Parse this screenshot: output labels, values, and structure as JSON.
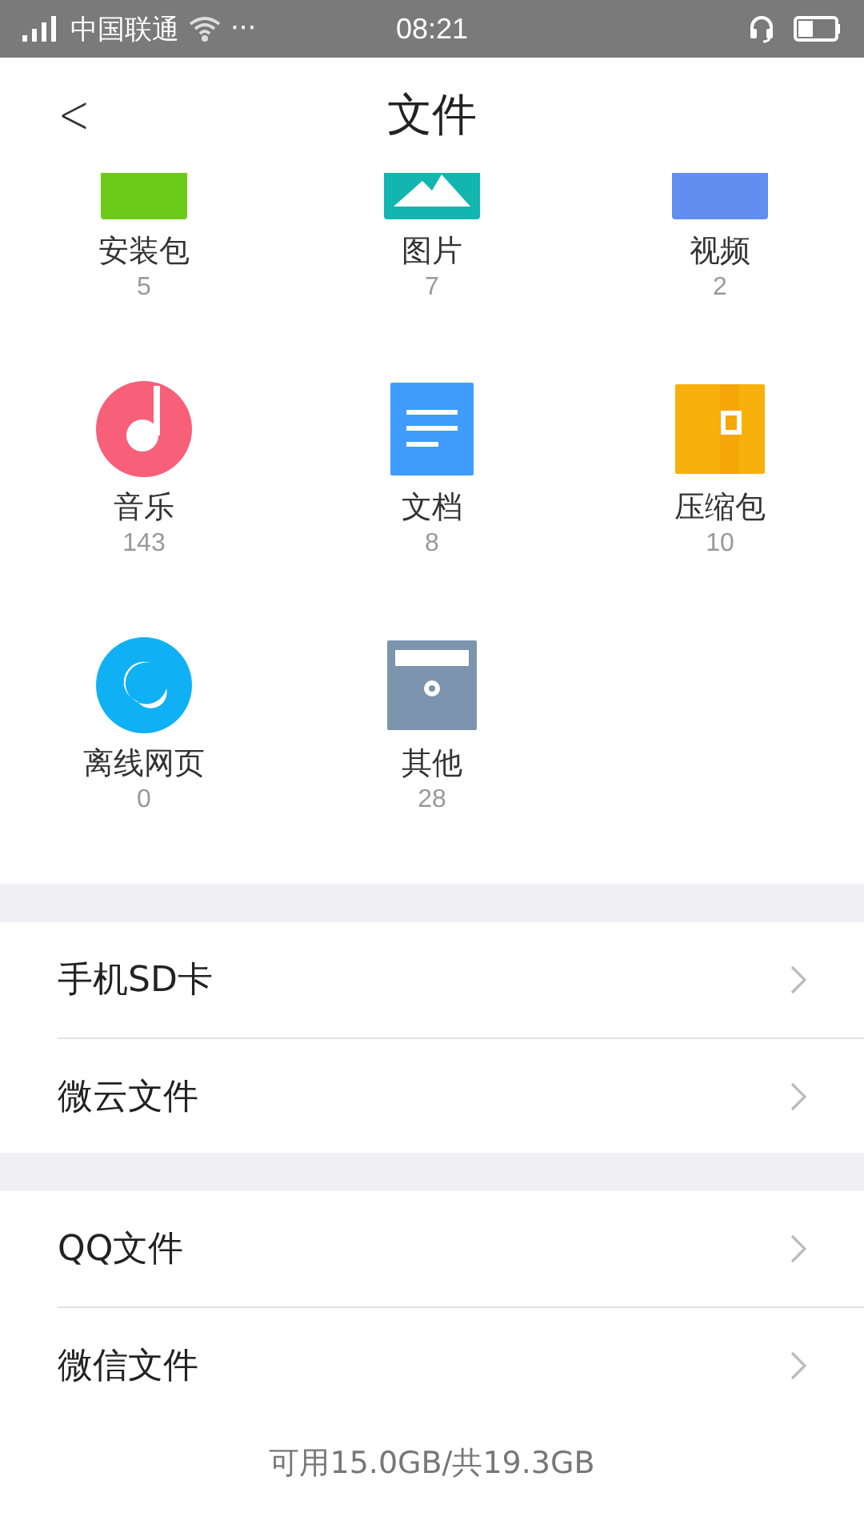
{
  "status_bar": {
    "carrier": "中国联通",
    "more": "···",
    "time": "08:21"
  },
  "header": {
    "back": "<",
    "title": "文件"
  },
  "categories": [
    {
      "kind": "apk",
      "label": "安装包",
      "count": "5"
    },
    {
      "kind": "image",
      "label": "图片",
      "count": "7"
    },
    {
      "kind": "video",
      "label": "视频",
      "count": "2"
    },
    {
      "kind": "music",
      "label": "音乐",
      "count": "143"
    },
    {
      "kind": "doc",
      "label": "文档",
      "count": "8"
    },
    {
      "kind": "zip",
      "label": "压缩包",
      "count": "10"
    },
    {
      "kind": "web",
      "label": "离线网页",
      "count": "0"
    },
    {
      "kind": "other",
      "label": "其他",
      "count": "28"
    }
  ],
  "sections": [
    [
      {
        "label": "手机SD卡"
      },
      {
        "label": "微云文件"
      }
    ],
    [
      {
        "label": "QQ文件"
      },
      {
        "label": "微信文件"
      }
    ]
  ],
  "footer": {
    "storage": "可用15.0GB/共19.3GB"
  }
}
